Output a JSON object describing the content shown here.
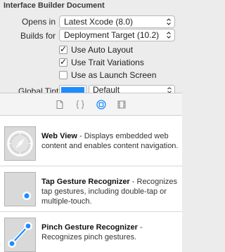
{
  "inspector": {
    "section_title": "Interface Builder Document",
    "opens_in": {
      "label": "Opens in",
      "value": "Latest Xcode (8.0)"
    },
    "builds_for": {
      "label": "Builds for",
      "value": "Deployment Target (10.2)"
    },
    "checkboxes": [
      {
        "label": "Use Auto Layout",
        "checked": true
      },
      {
        "label": "Use Trait Variations",
        "checked": true
      },
      {
        "label": "Use as Launch Screen",
        "checked": false
      }
    ],
    "global_tint": {
      "label": "Global Tint",
      "value": "Default",
      "color": "#1e8cff"
    }
  },
  "library_tabs": [
    {
      "icon": "file-icon"
    },
    {
      "icon": "code-braces-icon"
    },
    {
      "icon": "object-library-icon",
      "selected": true
    },
    {
      "icon": "media-library-icon"
    }
  ],
  "library": {
    "items": [
      {
        "title": "Web View",
        "description": " - Displays embedded web content and enables content navigation.",
        "icon": "compass-icon"
      },
      {
        "title": "Tap Gesture Recognizer",
        "description": " - Recognizes tap gestures, including double-tap or multiple-touch.",
        "icon": "tap-gesture-icon"
      },
      {
        "title": "Pinch Gesture Recognizer",
        "description": " - Recognizes pinch gestures.",
        "icon": "pinch-gesture-icon"
      }
    ]
  }
}
